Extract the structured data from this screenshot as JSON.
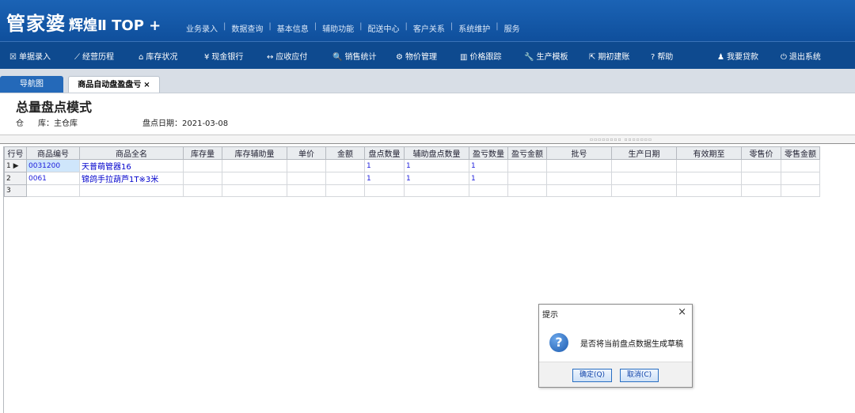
{
  "brand": {
    "main": "管家婆",
    "sub": "辉煌Ⅱ TOP +"
  },
  "topmenu": [
    "业务录入",
    "数据查询",
    "基本信息",
    "辅助功能",
    "配送中心",
    "客户关系",
    "系统维护",
    "服务"
  ],
  "toolbar": [
    {
      "icon": "☒",
      "label": "单据录入"
    },
    {
      "icon": "⟋",
      "label": "经营历程"
    },
    {
      "icon": "⌂",
      "label": "库存状况"
    },
    {
      "icon": "¥",
      "label": "现金银行"
    },
    {
      "icon": "↔",
      "label": "应收应付"
    },
    {
      "icon": "🔍",
      "label": "销售统计"
    },
    {
      "icon": "⚙",
      "label": "物价管理"
    },
    {
      "icon": "▥",
      "label": "价格跟踪"
    },
    {
      "icon": "🔧",
      "label": "生产模板"
    },
    {
      "icon": "⇱",
      "label": "期初建账"
    },
    {
      "icon": "?",
      "label": "帮助"
    },
    {
      "icon": "♟",
      "label": "我要贷款"
    },
    {
      "icon": "⏻",
      "label": "退出系统"
    }
  ],
  "tabs": {
    "nav": "导航图",
    "active": "商品自动盘盈盘亏",
    "close": "×"
  },
  "page": {
    "title": "总量盘点模式",
    "warehouse_icon": "仓",
    "warehouse": "库：主仓库",
    "date": "盘点日期：2021-03-08"
  },
  "grid": {
    "headers": [
      "行号",
      "商品编号",
      "商品全名",
      "库存量",
      "库存辅助量",
      "单价",
      "金额",
      "盘点数量",
      "辅助盘点数量",
      "盈亏数量",
      "盈亏金额",
      "批号",
      "生产日期",
      "有效期至",
      "零售价",
      "零售金额"
    ],
    "rows": [
      [
        "1 ▶",
        "0031200",
        "天普萌管器16",
        "",
        "",
        "",
        "",
        "1",
        "1",
        "1",
        "",
        "",
        "",
        "",
        "",
        ""
      ],
      [
        "2",
        "0061",
        "锦鸽手拉葫芦1T※3米",
        "",
        "",
        "",
        "",
        "1",
        "1",
        "1",
        "",
        "",
        "",
        "",
        "",
        ""
      ],
      [
        "3",
        "",
        "",
        "",
        "",
        "",
        "",
        "",
        "",
        "",
        "",
        "",
        "",
        "",
        "",
        ""
      ]
    ]
  },
  "dialog": {
    "title": "提示",
    "close": "×",
    "icon": "?",
    "message": "是否将当前盘点数据生成草稿",
    "ok": "确定(Q)",
    "cancel": "取消(C)"
  }
}
